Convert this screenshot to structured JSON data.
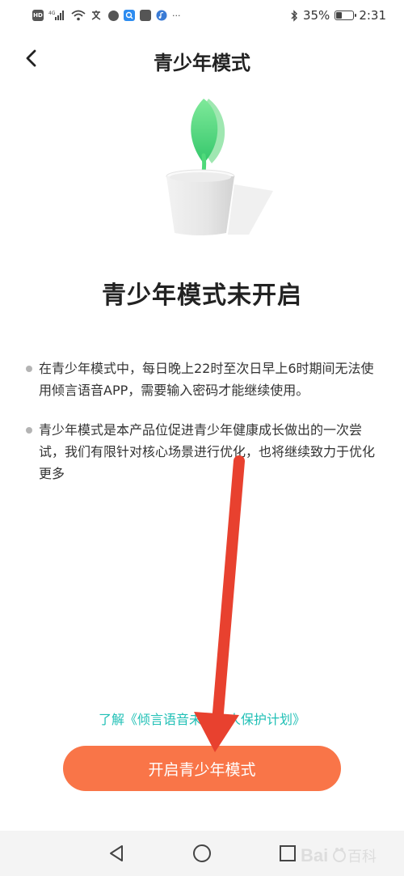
{
  "status_bar": {
    "left_icons": [
      "hd-icon",
      "signal-4g-icon",
      "wifi-icon",
      "language-icon",
      "app-circle-icon",
      "search-app-icon",
      "cat-app-icon",
      "music-app-icon",
      "more-icon"
    ],
    "hd_label": "HD",
    "net_label": "4G",
    "more_label": "···",
    "battery_percent": "35%",
    "battery_level": 0.35,
    "time": "2:31"
  },
  "header": {
    "title": "青少年模式"
  },
  "main": {
    "status_title": "青少年模式未开启",
    "info_items": [
      "在青少年模式中，每日晚上22时至次日早上6时期间无法使用倾言语音APP，需要输入密码才能继续使用。",
      "青少年模式是本产品位促进青少年健康成长做出的一次尝试，我们有限针对核心场景进行优化，也将继续致力于优化更多"
    ],
    "link_text": "了解《倾言语音未成年人保护计划》",
    "button_label": "开启青少年模式"
  },
  "nav_bar": {
    "buttons": [
      "back-triangle-icon",
      "home-circle-icon",
      "recent-square-icon"
    ]
  },
  "watermark": {
    "text": "Bai·百科"
  },
  "colors": {
    "accent_orange": "#f97548",
    "link_teal": "#21c0b6",
    "annotation_red": "#e8412f",
    "leaf_green": "#4fd97a"
  }
}
